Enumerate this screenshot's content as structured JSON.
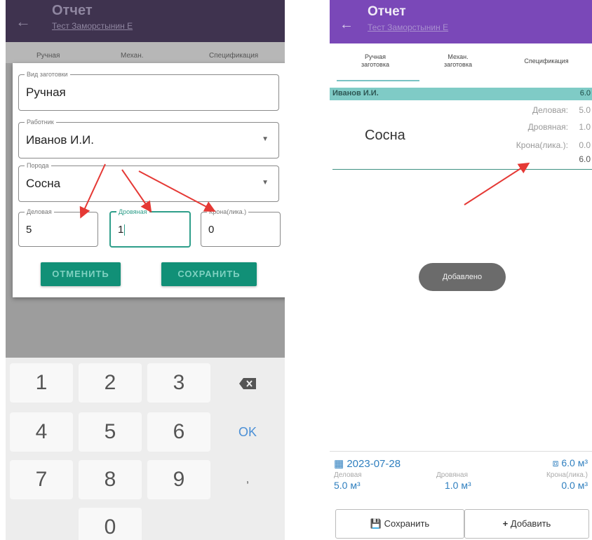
{
  "left": {
    "header": {
      "title": "Отчет",
      "subtitle": "Тест Заморстынин Е"
    },
    "tabs": [
      "Ручная",
      "Механ.",
      "Спецификация"
    ],
    "dialog": {
      "type_field": {
        "label": "Вид заготовки",
        "value": "Ручная"
      },
      "worker_field": {
        "label": "Работник",
        "value": "Иванов И.И."
      },
      "species_field": {
        "label": "Порода",
        "value": "Сосна"
      },
      "business_field": {
        "label": "Деловая",
        "value": "5"
      },
      "firewood_field": {
        "label": "Дровяная",
        "value": "1"
      },
      "crown_field": {
        "label": "Крона(лика.)",
        "value": "0"
      },
      "cancel_label": "ОТМЕНИТЬ",
      "save_label": "СОХРАНИТЬ"
    },
    "keypad": {
      "k1": "1",
      "k2": "2",
      "k3": "3",
      "k4": "4",
      "k5": "5",
      "k6": "6",
      "ok": "OK",
      "k7": "7",
      "k8": "8",
      "k9": "9",
      "comma": ",",
      "k0": "0",
      "del_icon": "backspace-icon"
    }
  },
  "right": {
    "header": {
      "title": "Отчет",
      "subtitle": "Тест Заморстынин Е"
    },
    "tabs": {
      "manual_line1": "Ручная",
      "manual_line2": "заготовка",
      "mech_line1": "Механ.",
      "mech_line2": "заготовка",
      "spec": "Спецификация"
    },
    "row": {
      "name": "Иванов И.И.",
      "total": "6.0"
    },
    "species": "Сосна",
    "details": [
      {
        "label": "Деловая:",
        "value": "5.0"
      },
      {
        "label": "Дровяная:",
        "value": "1.0"
      },
      {
        "label": "Крона(лика.):",
        "value": "0.0"
      }
    ],
    "sum": "6.0",
    "toast": "Добавлено",
    "bottom": {
      "date": "2023-07-28",
      "volume": "6.0 м³",
      "business_label": "Деловая",
      "business_value": "5.0 м³",
      "firewood_label": "Дровяная",
      "firewood_value": "1.0 м³",
      "crown_label": "Крона(лика.)",
      "crown_value": "0.0 м³",
      "save_label": "Сохранить",
      "add_label": "Добавить"
    }
  },
  "colors": {
    "left_header": "#3f334f",
    "right_header": "#7a48b8",
    "teal_button": "#119077",
    "row_highlight": "#7fcbc6",
    "accent_blue": "#2f7fbf",
    "annotation_arrow": "#e53935"
  }
}
